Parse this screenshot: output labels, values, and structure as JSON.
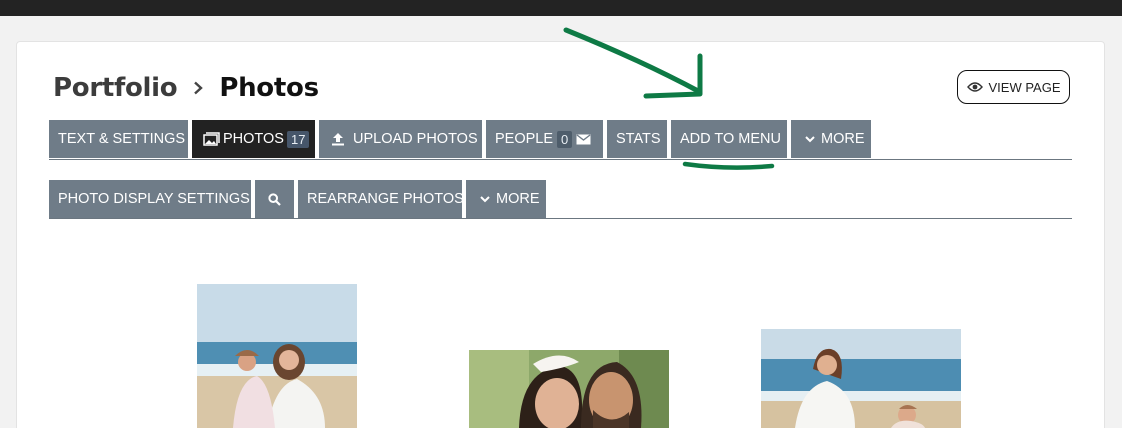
{
  "breadcrumb": {
    "parent": "Portfolio",
    "current": "Photos"
  },
  "view_page_label": "VIEW PAGE",
  "tabs_primary": {
    "text_settings": "TEXT & SETTINGS",
    "photos": "PHOTOS",
    "photos_count": "17",
    "upload_photos": "UPLOAD PHOTOS",
    "people": "PEOPLE",
    "people_count": "0",
    "stats": "STATS",
    "add_to_menu": "ADD TO MENU",
    "more": "MORE"
  },
  "tabs_secondary": {
    "photo_display_settings": "PHOTO DISPLAY SETTINGS",
    "rearrange_photos": "REARRANGE PHOTOS",
    "more": "MORE"
  },
  "icons": {
    "view": "eye-icon",
    "photos": "gallery-icon",
    "upload": "upload-icon",
    "email": "envelope-icon",
    "more": "chevron-down-icon",
    "search": "search-icon"
  },
  "colors": {
    "tab_bg": "#6f7c88",
    "tab_active_bg": "#222222",
    "annotation": "#0e7a45"
  }
}
